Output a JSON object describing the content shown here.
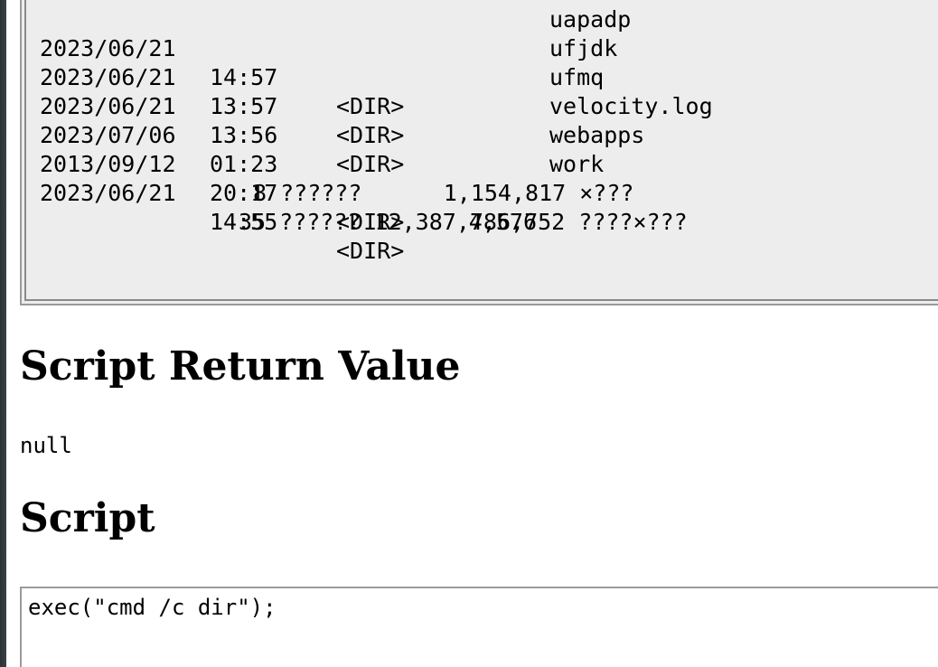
{
  "listing": {
    "rows": [
      {
        "date": "2023/06/21",
        "time": "14:57",
        "dir": "<DIR>",
        "size": "",
        "name": "uapadp"
      },
      {
        "date": "2023/06/21",
        "time": "13:57",
        "dir": "<DIR>",
        "size": "",
        "name": "ufjdk"
      },
      {
        "date": "2023/06/21",
        "time": "13:56",
        "dir": "<DIR>",
        "size": "",
        "name": "ufmq"
      },
      {
        "date": "2023/07/06",
        "time": "01:23",
        "dir": "",
        "size": "4,576",
        "name": "velocity.log"
      },
      {
        "date": "2013/09/12",
        "time": "20:17",
        "dir": "<DIR>",
        "size": "",
        "name": "webapps"
      },
      {
        "date": "2023/06/21",
        "time": "14:55",
        "dir": "<DIR>",
        "size": "",
        "name": "work"
      }
    ],
    "summary": {
      "files_line": "8 ??????      1,154,817 ×???",
      "dirs_line": "35 ?????? 12,387,786,752 ????×???"
    }
  },
  "return_section": {
    "heading": "Script Return Value",
    "value": "null"
  },
  "script_section": {
    "heading": "Script",
    "code": "exec(\"cmd /c dir\");"
  }
}
